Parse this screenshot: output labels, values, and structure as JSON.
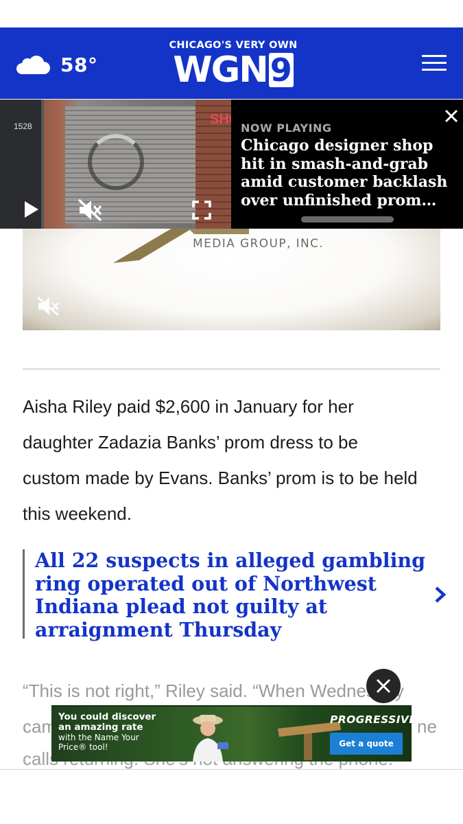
{
  "header": {
    "weather_temp": "58°",
    "logo_tagline": "CHICAGO'S VERY OWN",
    "logo_text": "WGN",
    "logo_channel": "9"
  },
  "background_media": {
    "caption": "MEDIA GROUP, INC."
  },
  "player": {
    "now_playing_label": "NOW PLAYING",
    "title_lines": [
      "Chicago designer shop",
      "hit in smash-and-grab",
      "amid customer backlash",
      "over unfinished prom…"
    ],
    "thumb_door_number": "1528",
    "thumb_sign": "SHO"
  },
  "article": {
    "paragraph1_lines": [
      "Aisha Riley paid $2,600 in January for her",
      "daughter Zadazia Banks’ prom dress to be",
      "custom made by Evans. Banks’ prom is to be held",
      "this weekend."
    ],
    "related_lines": [
      "All 22 suspects in alleged gambling",
      "ring operated out of Northwest",
      "Indiana plead not guilty at",
      "arraignment Thursday"
    ],
    "paragraph2_line1": "“This is not right,” Riley said. “When Wednesday",
    "paragraph2_line2_start": "cam",
    "paragraph2_line2_end": "ne",
    "paragraph2_line3": "calls returning. She’s not answering the phone."
  },
  "ad": {
    "line1": "You could discover",
    "line2": "an amazing rate",
    "line3": "with the Name Your",
    "line4": "Price® tool!",
    "brand": "PROGRESSIVE",
    "cta": "Get a quote"
  },
  "colors": {
    "brand_blue": "#1434c8",
    "related_link": "#1434c8",
    "ad_cta": "#1c7fd6"
  }
}
